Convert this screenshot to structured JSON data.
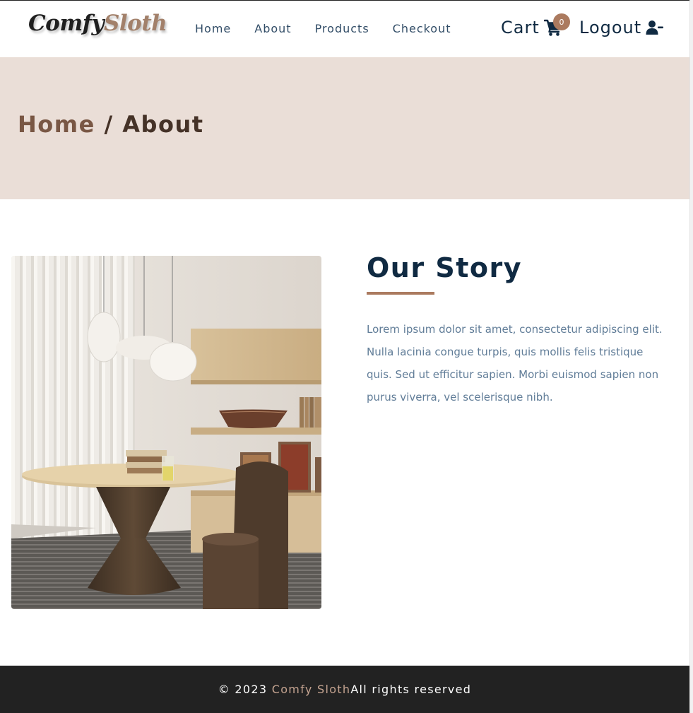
{
  "navbar": {
    "logo_part1": "Comfy",
    "logo_part2": "Sloth",
    "links": [
      {
        "label": "Home"
      },
      {
        "label": "About"
      },
      {
        "label": "Products"
      },
      {
        "label": "Checkout"
      }
    ],
    "cart_label": "Cart",
    "cart_count": "0",
    "logout_label": "Logout"
  },
  "hero": {
    "crumb_home": "Home",
    "crumb_separator": " / ",
    "crumb_current": "About"
  },
  "story": {
    "title": "Our Story",
    "text": "Lorem ipsum dolor sit amet, consectetur adipiscing elit. Nulla lacinia congue turpis, quis mollis felis tristique quis. Sed ut efficitur sapien. Morbi euismod sapien non purus viverra, vel scelerisque nibh."
  },
  "footer": {
    "copyright": "© 2023",
    "brand": "Comfy Sloth",
    "rights": "All rights reserved"
  },
  "colors": {
    "accent": "#ab7a5f",
    "hero_bg": "#eaded7",
    "title": "#102a42",
    "body_text": "#617d98",
    "footer_bg": "#222222"
  },
  "icons": {
    "cart": "shopping-cart-icon",
    "logout": "user-minus-icon"
  }
}
